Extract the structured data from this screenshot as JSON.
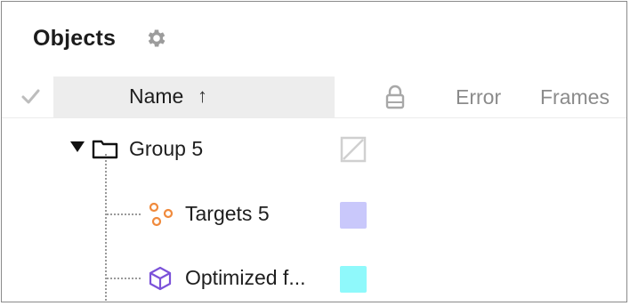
{
  "panel": {
    "title": "Objects",
    "settings_icon": "gear-icon"
  },
  "header": {
    "select_all_icon": "checkmark-icon",
    "name_label": "Name",
    "sort_indicator": "↑",
    "lock_icon": "lock-icon",
    "error_label": "Error",
    "frames_label": "Frames"
  },
  "tree": {
    "group": {
      "label": "Group 5",
      "expanded": true,
      "icon": "folder-icon",
      "disclosure_icon": "triangle-down-icon",
      "color_icon": "no-color-icon"
    },
    "children": [
      {
        "label": "Targets 5",
        "icon": "targets-icon",
        "color": "#c9c8fb"
      },
      {
        "label": "Optimized f...",
        "icon": "cube-icon",
        "color": "#8ff9fb"
      }
    ]
  },
  "colors": {
    "header_highlight": "#ededed",
    "targets_icon": "#f08a3c",
    "cube_icon": "#7b52d9"
  }
}
